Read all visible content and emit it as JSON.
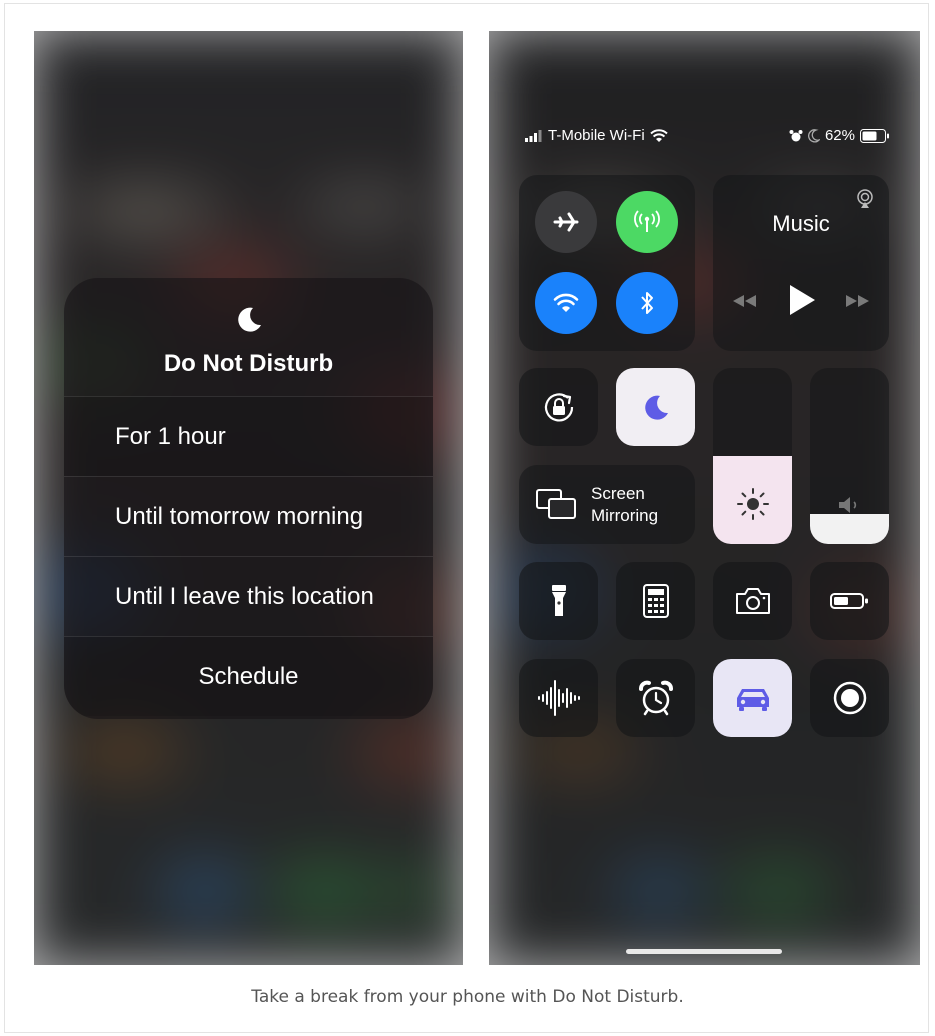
{
  "dnd_menu": {
    "title": "Do Not Disturb",
    "options": [
      "For 1 hour",
      "Until tomorrow morning",
      "Until I leave this location",
      "Schedule"
    ]
  },
  "status_bar": {
    "carrier": "T-Mobile Wi-Fi",
    "battery": "62%"
  },
  "music": {
    "title": "Music"
  },
  "screen_mirroring": {
    "line1": "Screen",
    "line2": "Mirroring"
  },
  "levels": {
    "brightness_fraction": 0.5,
    "volume_fraction": 0.17
  },
  "colors": {
    "cellular_green": "#4cd964",
    "wifi_blue": "#1a82fb",
    "bluetooth_blue": "#1a82fb",
    "dnd_purple": "#5e5ce6"
  },
  "caption": "Take a break from your phone with Do Not Disturb."
}
